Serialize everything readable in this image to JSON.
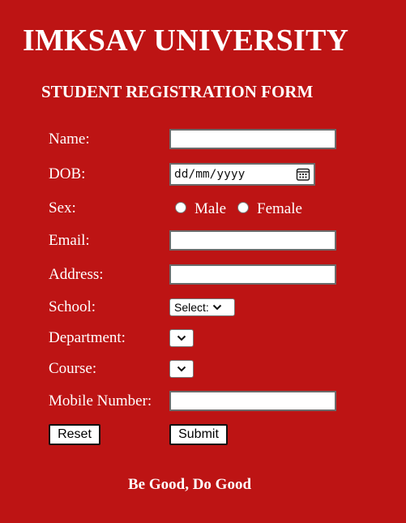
{
  "header": {
    "title": "IMKSAV UNIVERSITY",
    "subtitle": "STUDENT REGISTRATION FORM"
  },
  "form": {
    "name": {
      "label": "Name:",
      "value": ""
    },
    "dob": {
      "label": "DOB:",
      "placeholder": "dd/mm/yyyy",
      "icon": "calendar-icon"
    },
    "sex": {
      "label": "Sex:",
      "options": [
        "Male",
        "Female"
      ],
      "selected": null
    },
    "email": {
      "label": "Email:",
      "value": ""
    },
    "address": {
      "label": "Address:",
      "value": ""
    },
    "school": {
      "label": "School:",
      "selected": "Select:"
    },
    "department": {
      "label": "Department:",
      "selected": ""
    },
    "course": {
      "label": "Course:",
      "selected": ""
    },
    "mobile": {
      "label": "Mobile Number:",
      "value": ""
    },
    "buttons": {
      "reset": "Reset",
      "submit": "Submit"
    }
  },
  "footer": {
    "motto": "Be Good, Do Good"
  },
  "colors": {
    "background": "#bd1414",
    "text": "#ffffff",
    "field_background": "#ffffff"
  }
}
